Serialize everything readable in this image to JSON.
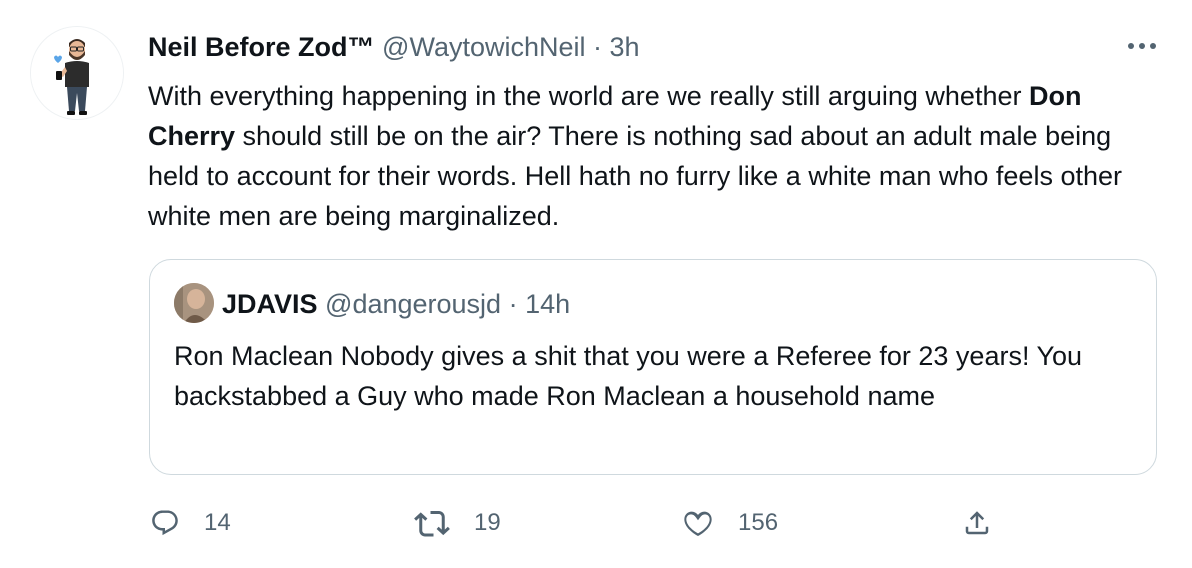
{
  "tweet": {
    "author": {
      "display_name": "Neil Before Zod™",
      "handle": "@WaytowichNeil",
      "separator": "·",
      "time": "3h",
      "avatar_icon": "bitmoji-avatar"
    },
    "more_icon": "more-horizontal-icon",
    "text": {
      "part1": "With everything happening in the world are we really still arguing whether ",
      "bold": "Don Cherry",
      "part2": " should still be on the air? There is nothing sad about an adult male being held to account for their words. Hell hath no furry like a white man who feels other white men are being marginalized."
    },
    "quoted": {
      "display_name": "JDAVIS",
      "handle": "@dangerousjd",
      "separator": "·",
      "time": "14h",
      "avatar_icon": "profile-photo",
      "text": "Ron Maclean Nobody gives a shit that you were a Referee for 23 years! You backstabbed a Guy who made Ron Maclean a household name"
    },
    "actions": {
      "reply": {
        "icon": "reply-icon",
        "count": "14"
      },
      "retweet": {
        "icon": "retweet-icon",
        "count": "19"
      },
      "like": {
        "icon": "heart-icon",
        "count": "156"
      },
      "share": {
        "icon": "share-icon"
      }
    }
  },
  "colors": {
    "text_primary": "#0f1419",
    "text_secondary": "#536471",
    "border": "#cfd9de",
    "background": "#ffffff"
  }
}
